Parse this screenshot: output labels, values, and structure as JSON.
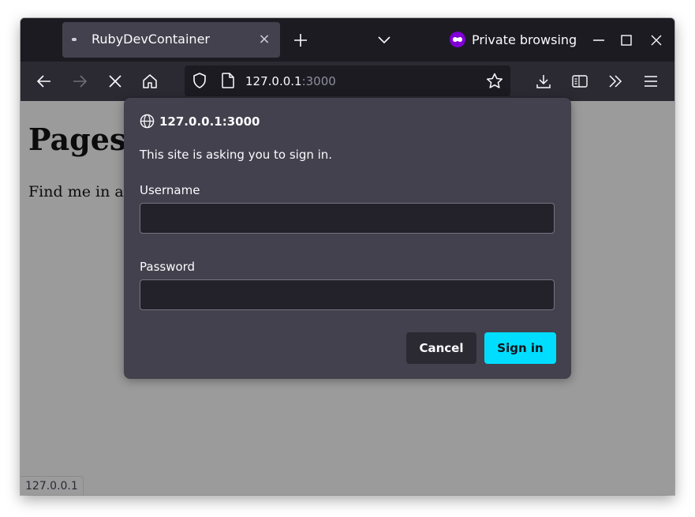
{
  "browser": {
    "tab": {
      "title": "RubyDevContainer",
      "close_glyph": "×"
    },
    "new_tab_glyph": "+",
    "private_browsing_label": "Private browsing",
    "url": {
      "host": "127.0.0.1",
      "port": ":3000"
    },
    "status_text": "127.0.0.1",
    "colors": {
      "private_accent": "#8000d7",
      "primary_button": "#00ddff"
    }
  },
  "page": {
    "heading": "Pages",
    "paragraph": "Find me in a"
  },
  "dialog": {
    "origin": "127.0.0.1:3000",
    "message": "This site is asking you to sign in.",
    "username_label": "Username",
    "username_value": "",
    "password_label": "Password",
    "password_value": "",
    "cancel_label": "Cancel",
    "signin_label": "Sign in"
  }
}
